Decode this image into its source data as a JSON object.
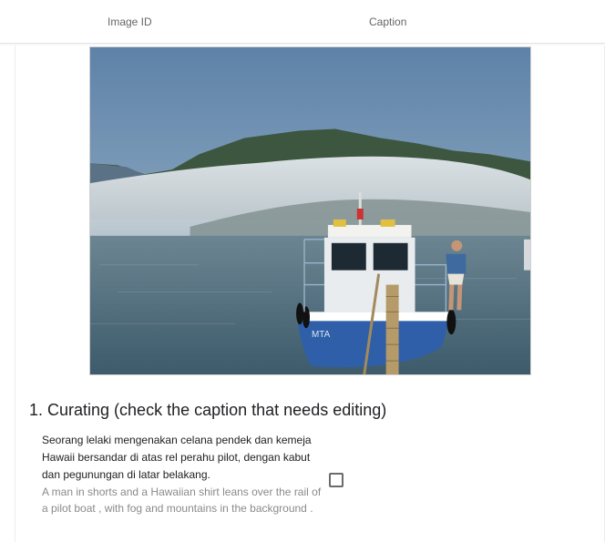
{
  "header": {
    "image_id_label": "Image ID",
    "caption_label": "Caption"
  },
  "image": {
    "alt": "A man in shorts and a Hawaiian shirt leans over the rail of a pilot boat, with fog and mountains in the background.",
    "boat_hull_text": "MTA"
  },
  "section": {
    "title": "1. Curating (check the caption that needs editing)"
  },
  "caption": {
    "indonesian": "Seorang lelaki mengenakan celana pendek dan kemeja Hawaii bersandar di atas rel perahu pilot, dengan kabut dan pegunungan di latar belakang.",
    "english": "A man in shorts and a Hawaiian shirt leans over the rail of a pilot boat , with fog and mountains in the background .",
    "needs_editing": false
  },
  "colors": {
    "sky": "#6d8fb0",
    "water": "#4f6f80",
    "fog": "#d6dde3",
    "hill": "#3f5a3f",
    "hull": "#2f5fa8"
  }
}
